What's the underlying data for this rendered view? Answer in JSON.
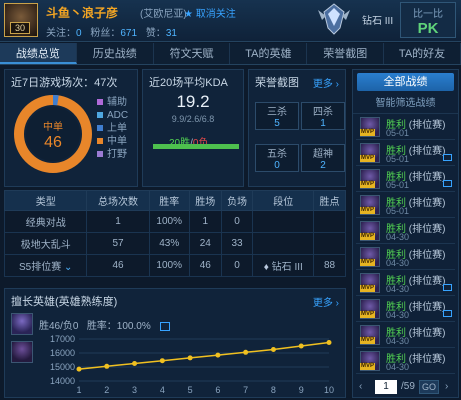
{
  "header": {
    "level": "30",
    "player_name": "斗鱼丶浪子彦",
    "server": "(艾欧尼亚)",
    "unfollow": "取消关注",
    "follow_label": "关注：",
    "follow_value": "0",
    "fans_label": "粉丝：",
    "fans_value": "671",
    "posts_label": "赞：",
    "posts_value": "31",
    "rank": "钻石 III",
    "pk_title": "比一比",
    "pk": "PK"
  },
  "tabs": [
    "战绩总览",
    "历史战绩",
    "符文天赋",
    "TA的英雄",
    "荣誉截图",
    "TA的好友"
  ],
  "recent": {
    "title": "近7日游戏场次：47次",
    "role_main": "中单",
    "role_count": "46",
    "legend": [
      {
        "label": "辅助",
        "color": "#b06ad8"
      },
      {
        "label": "ADC",
        "color": "#4fa7e0"
      },
      {
        "label": "上单",
        "color": "#3f7ed0"
      },
      {
        "label": "中单",
        "color": "#e8862a"
      },
      {
        "label": "打野",
        "color": "#9b7bd3"
      }
    ]
  },
  "kda": {
    "title": "近20场平均KDA",
    "value": "19.2",
    "detail": "9.9/2.6/6.8",
    "wins": "20胜",
    "losses": "0负",
    "win_rate": 1.0
  },
  "honor": {
    "title": "荣誉截图",
    "more": "更多",
    "items": [
      {
        "label": "三杀",
        "value": "5"
      },
      {
        "label": "四杀",
        "value": "1"
      },
      {
        "label": "五杀",
        "value": "0"
      },
      {
        "label": "超神",
        "value": "2"
      }
    ]
  },
  "table": {
    "headers": [
      "类型",
      "总场次数",
      "胜率",
      "胜场",
      "负场",
      "段位",
      "胜点"
    ],
    "rows": [
      {
        "type": "经典对战",
        "total": "1",
        "rate": "100%",
        "win": "1",
        "lose": "0",
        "tier": "",
        "points": ""
      },
      {
        "type": "极地大乱斗",
        "total": "57",
        "rate": "43%",
        "win": "24",
        "lose": "33",
        "tier": "",
        "points": ""
      },
      {
        "type": "S5排位赛",
        "total": "46",
        "rate": "100%",
        "win": "46",
        "lose": "0",
        "tier": "钻石 III",
        "points": "88"
      }
    ]
  },
  "mastery": {
    "title": "擅长英雄(英雄熟练度)",
    "more": "更多",
    "record": "胜46/负0",
    "win_rate_label": "胜率：100.0%"
  },
  "chart_data": {
    "type": "line",
    "x": [
      1,
      2,
      3,
      4,
      5,
      6,
      7,
      8,
      9,
      10
    ],
    "values": [
      14850,
      15050,
      15250,
      15450,
      15650,
      15850,
      16050,
      16250,
      16500,
      16750
    ],
    "yticks": [
      "17000",
      "16000",
      "15000",
      "14000"
    ],
    "ylim": [
      14000,
      17000
    ],
    "line_color": "#f0c020"
  },
  "sidebar": {
    "all_matches": "全部战绩",
    "smart_filter": "智能筛选战绩",
    "mvp": "MVP",
    "matches": [
      {
        "result": "胜利",
        "queue": "(排位赛)",
        "date": "05-01",
        "has_icon": false
      },
      {
        "result": "胜利",
        "queue": "(排位赛)",
        "date": "05-01",
        "has_icon": true
      },
      {
        "result": "胜利",
        "queue": "(排位赛)",
        "date": "05-01",
        "has_icon": true
      },
      {
        "result": "胜利",
        "queue": "(排位赛)",
        "date": "05-01",
        "has_icon": false
      },
      {
        "result": "胜利",
        "queue": "(排位赛)",
        "date": "04-30",
        "has_icon": false
      },
      {
        "result": "胜利",
        "queue": "(排位赛)",
        "date": "04-30",
        "has_icon": false
      },
      {
        "result": "胜利",
        "queue": "(排位赛)",
        "date": "04-30",
        "has_icon": true
      },
      {
        "result": "胜利",
        "queue": "(排位赛)",
        "date": "04-30",
        "has_icon": true
      },
      {
        "result": "胜利",
        "queue": "(排位赛)",
        "date": "04-30",
        "has_icon": false
      },
      {
        "result": "胜利",
        "queue": "(排位赛)",
        "date": "04-30",
        "has_icon": false
      }
    ],
    "page_current": "1",
    "page_total": "/59",
    "go": "GO"
  }
}
